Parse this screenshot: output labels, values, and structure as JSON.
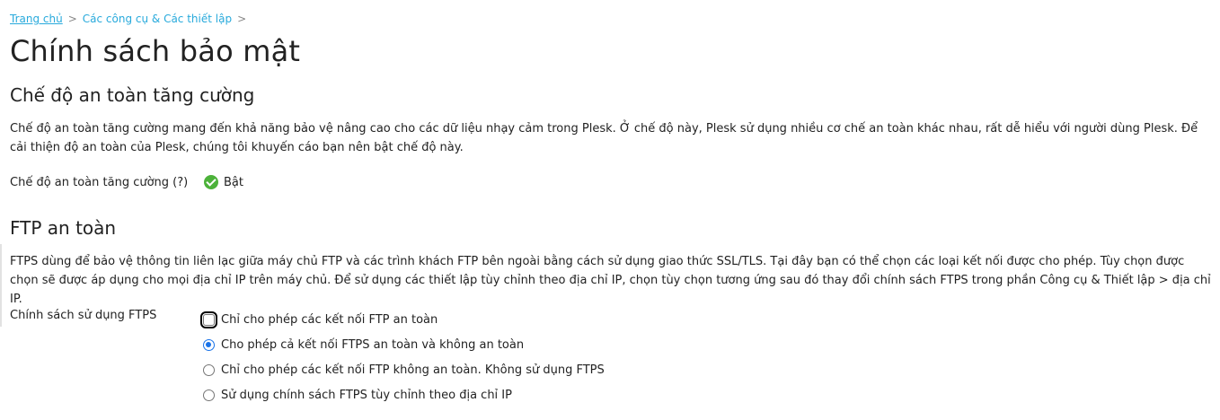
{
  "breadcrumb": {
    "home": "Trang chủ",
    "sep": ">",
    "tools": "Các công cụ & Các thiết lập"
  },
  "page": {
    "title": "Chính sách bảo mật"
  },
  "enhanced_security": {
    "title": "Chế độ an toàn tăng cường",
    "description": "Chế độ an toàn tăng cường mang đến khả năng bảo vệ nâng cao cho các dữ liệu nhạy cảm trong Plesk. Ở chế độ này, Plesk sử dụng nhiều cơ chế an toàn khác nhau, rất dễ hiểu với người dùng Plesk. Để cải thiện độ an toàn của Plesk, chúng tôi khuyến cáo bạn nên bật chế độ này.",
    "field_label": "Chế độ an toàn tăng cường (?)",
    "status": "Bật",
    "status_color": "#4cb23a"
  },
  "secure_ftp": {
    "title": "FTP an toàn",
    "description": "FTPS dùng để bảo vệ thông tin liên lạc giữa máy chủ FTP và các trình khách FTP bên ngoài bằng cách sử dụng giao thức SSL/TLS. Tại đây bạn có thể chọn các loại kết nối được cho phép. Tùy chọn được chọn sẽ được áp dụng cho mọi địa chỉ IP trên máy chủ. Để sử dụng các thiết lập tùy chỉnh theo địa chỉ IP, chọn tùy chọn tương ứng sau đó thay đổi chính sách FTPS trong phần Công cụ & Thiết lập > địa chỉ IP.",
    "field_label": "Chính sách sử dụng FTPS",
    "options": [
      {
        "label": "Chỉ cho phép các kết nối FTP an toàn",
        "selected": false,
        "focused": true
      },
      {
        "label": "Cho phép cả kết nối FTPS an toàn và không an toàn",
        "selected": true,
        "focused": false
      },
      {
        "label": "Chỉ cho phép các kết nối FTP không an toàn. Không sử dụng FTPS",
        "selected": false,
        "focused": false
      },
      {
        "label": "Sử dụng chính sách FTPS tùy chỉnh theo địa chỉ IP",
        "selected": false,
        "focused": false
      }
    ]
  },
  "colors": {
    "link": "#28aadc",
    "radio_selected": "#1a73e8",
    "text": "#222222"
  }
}
